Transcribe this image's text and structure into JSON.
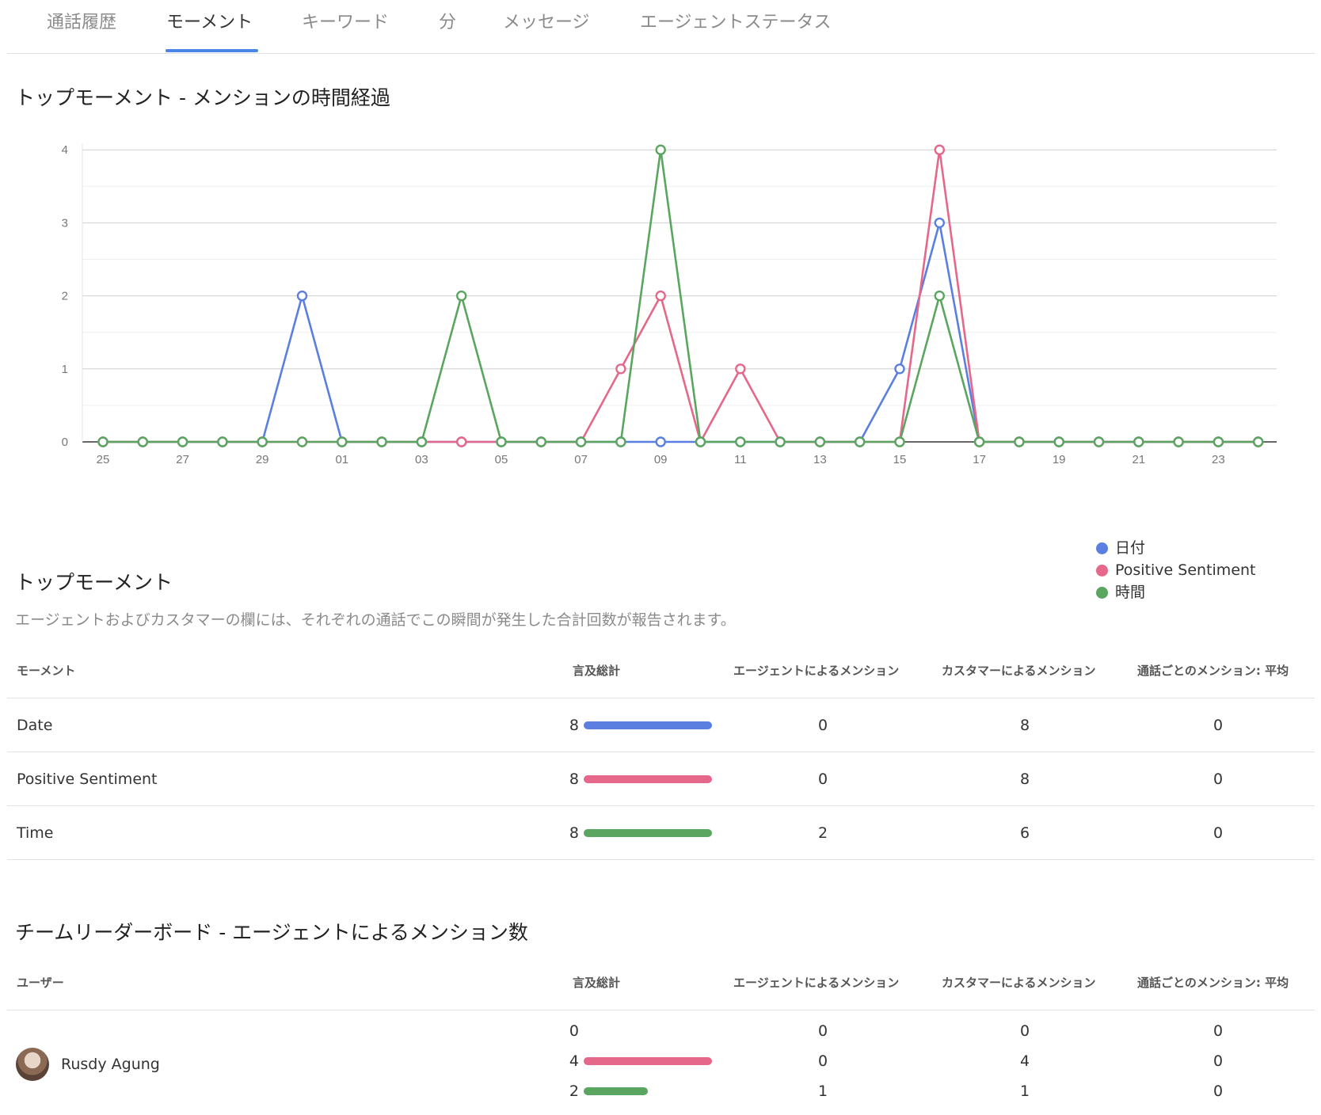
{
  "tabs": [
    {
      "label": "通話履歴",
      "active": false
    },
    {
      "label": "モーメント",
      "active": true
    },
    {
      "label": "キーワード",
      "active": false
    },
    {
      "label": "分",
      "active": false
    },
    {
      "label": "メッセージ",
      "active": false
    },
    {
      "label": "エージェントステータス",
      "active": false
    }
  ],
  "chart_section": {
    "title": "トップモーメント - メンションの時間経過"
  },
  "chart_data": {
    "type": "line",
    "x": [
      "25",
      "26",
      "27",
      "28",
      "29",
      "30",
      "01",
      "02",
      "03",
      "04",
      "05",
      "06",
      "07",
      "08",
      "09",
      "10",
      "11",
      "12",
      "13",
      "14",
      "15",
      "16",
      "17",
      "18",
      "19",
      "20",
      "21",
      "22",
      "23",
      "24"
    ],
    "xtick_labels": [
      "25",
      "27",
      "29",
      "01",
      "03",
      "05",
      "07",
      "09",
      "11",
      "13",
      "15",
      "17",
      "19",
      "21",
      "23"
    ],
    "ylim": [
      0,
      4
    ],
    "yticks": [
      0,
      1,
      2,
      3,
      4
    ],
    "grid": true,
    "legend_position": "bottom-right",
    "series": [
      {
        "name": "日付",
        "color": "#5b7fe0",
        "values": [
          0,
          0,
          0,
          0,
          0,
          2,
          0,
          0,
          0,
          0,
          0,
          0,
          0,
          0,
          0,
          0,
          0,
          0,
          0,
          0,
          1,
          3,
          0,
          0,
          0,
          0,
          0,
          0,
          0,
          0
        ]
      },
      {
        "name": "Positive Sentiment",
        "color": "#e5678a",
        "values": [
          0,
          0,
          0,
          0,
          0,
          0,
          0,
          0,
          0,
          0,
          0,
          0,
          0,
          1,
          2,
          0,
          1,
          0,
          0,
          0,
          0,
          4,
          0,
          0,
          0,
          0,
          0,
          0,
          0,
          0
        ]
      },
      {
        "name": "時間",
        "color": "#5aa55f",
        "values": [
          0,
          0,
          0,
          0,
          0,
          0,
          0,
          0,
          0,
          2,
          0,
          0,
          0,
          0,
          4,
          0,
          0,
          0,
          0,
          0,
          0,
          2,
          0,
          0,
          0,
          0,
          0,
          0,
          0,
          0
        ]
      }
    ]
  },
  "legend": {
    "items": [
      {
        "label": "日付",
        "color": "#5b7fe0"
      },
      {
        "label": "Positive Sentiment",
        "color": "#e5678a"
      },
      {
        "label": "時間",
        "color": "#5aa55f"
      }
    ]
  },
  "moments_section": {
    "title": "トップモーメント",
    "subtitle": "エージェントおよびカスタマーの欄には、それぞれの通話でこの瞬間が発生した合計回数が報告されます。",
    "headers": {
      "moment": "モーメント",
      "total": "言及総計",
      "agent": "エージェントによるメンション",
      "customer": "カスタマーによるメンション",
      "avg": "通話ごとのメンション: 平均"
    },
    "max_total": 8,
    "rows": [
      {
        "name": "Date",
        "total": "8",
        "total_value": 8,
        "color": "#5b7fe0",
        "agent": "0",
        "customer": "8",
        "avg": "0"
      },
      {
        "name": "Positive Sentiment",
        "total": "8",
        "total_value": 8,
        "color": "#e5678a",
        "agent": "0",
        "customer": "8",
        "avg": "0"
      },
      {
        "name": "Time",
        "total": "8",
        "total_value": 8,
        "color": "#5aa55f",
        "agent": "2",
        "customer": "6",
        "avg": "0"
      }
    ]
  },
  "leaderboard": {
    "title": "チームリーダーボード - エージェントによるメンション数",
    "headers": {
      "user": "ユーザー",
      "total": "言及総計",
      "agent": "エージェントによるメンション",
      "customer": "カスタマーによるメンション",
      "avg": "通話ごとのメンション: 平均"
    },
    "max_total": 4,
    "users": [
      {
        "name": "Rusdy Agung",
        "stats": [
          {
            "total": "0",
            "total_value": 0,
            "color": "#5b7fe0",
            "agent": "0",
            "customer": "0",
            "avg": "0"
          },
          {
            "total": "4",
            "total_value": 4,
            "color": "#e5678a",
            "agent": "0",
            "customer": "4",
            "avg": "0"
          },
          {
            "total": "2",
            "total_value": 2,
            "color": "#5aa55f",
            "agent": "1",
            "customer": "1",
            "avg": "0"
          }
        ]
      }
    ]
  }
}
